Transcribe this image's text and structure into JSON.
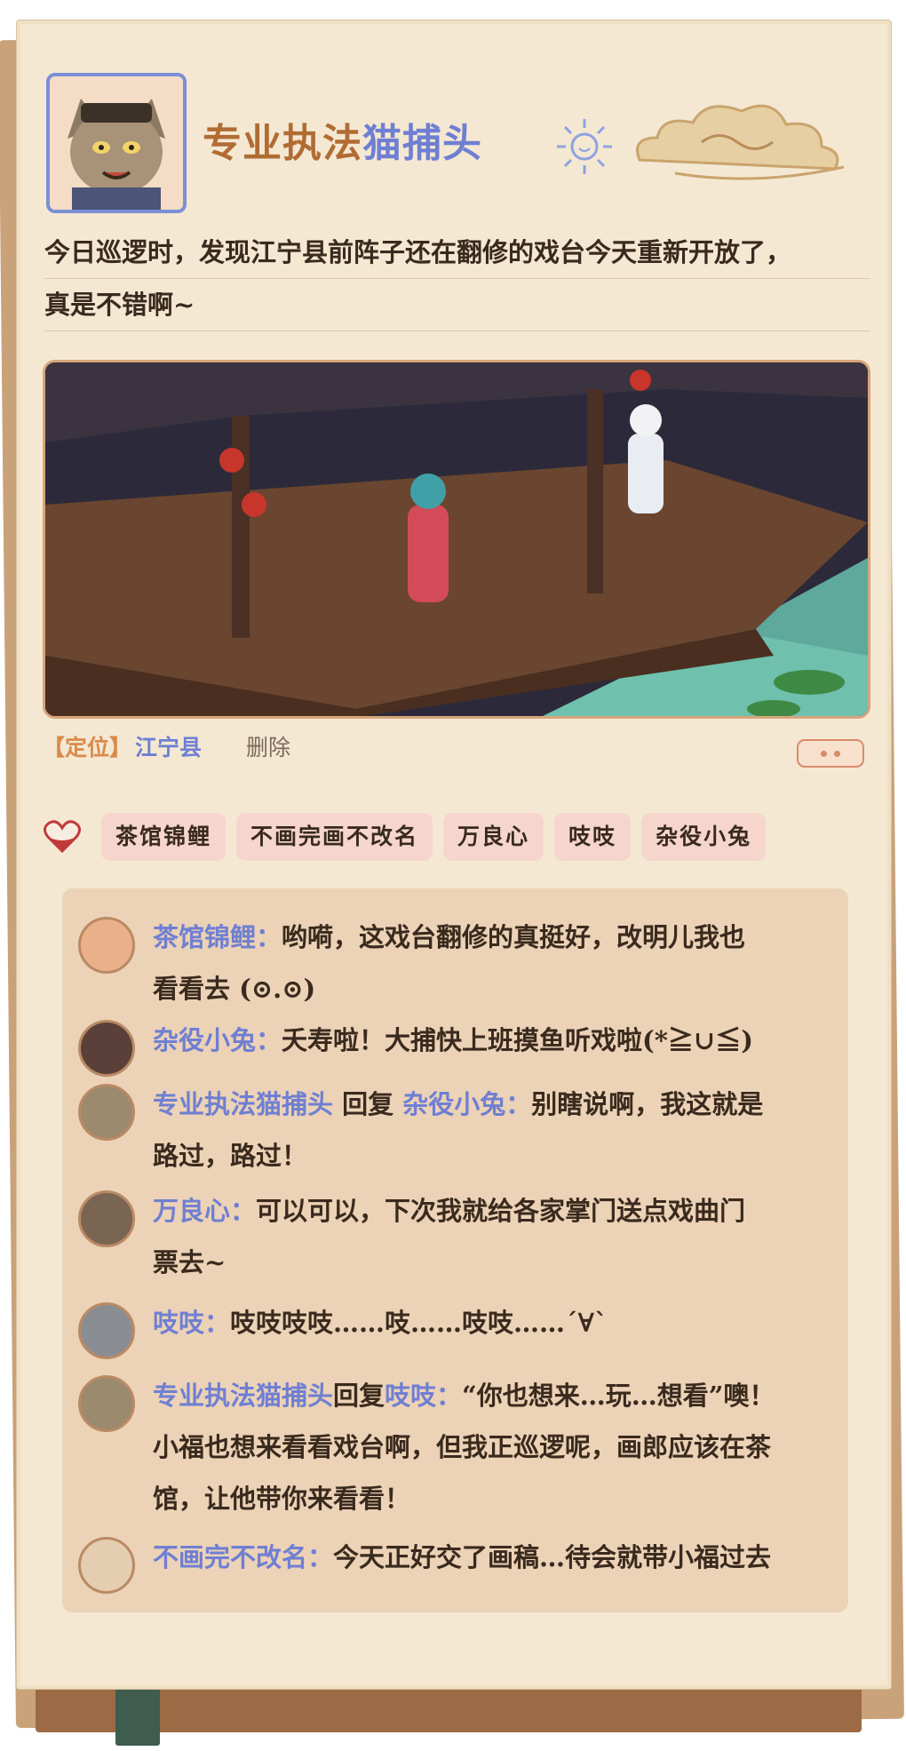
{
  "post": {
    "author_name_part1": "专业执法",
    "author_name_part2": "猫",
    "author_name_part3": "捕头",
    "text_line1": "今日巡逻时，发现江宁县前阵子还在翻修的戏台今天重新开放了，",
    "text_line2": "真是不错啊~",
    "location_tag": "【定位】",
    "location_name": "江宁县",
    "delete_label": "删除"
  },
  "likes": [
    "茶馆锦鲤",
    "不画完画不改名",
    "万良心",
    "吱吱",
    "杂役小兔"
  ],
  "comments": [
    {
      "name": "茶馆锦鲤：",
      "line1": "哟嗬，这戏台翻修的真挺好，改明儿我也",
      "line2": "看看去 (⊙.⊙)"
    },
    {
      "name": "杂役小兔：",
      "line1": "夭寿啦！大捕快上班摸鱼听戏啦(*≧∪≦)"
    },
    {
      "name": "专业执法猫捕头",
      "reply_word": " 回复 ",
      "reply_to": "杂役小兔：",
      "line1": "别瞎说啊，我这就是",
      "line2": "路过，路过！"
    },
    {
      "name": "万良心：",
      "line1": "可以可以，下次我就给各家掌门送点戏曲门",
      "line2": "票去~"
    },
    {
      "name": "吱吱：",
      "line1": "吱吱吱吱……吱……吱吱……´∀`"
    },
    {
      "name": "专业执法猫捕头",
      "reply_word": "回复",
      "reply_to": "吱吱：",
      "line1": "“你也想来…玩…想看”噢！",
      "line2": "小福也想来看看戏台啊，但我正巡逻呢，画郎应该在茶",
      "line3": "馆，让他带你来看看！"
    },
    {
      "name": "不画完不改名：",
      "line1": "今天正好交了画稿…待会就带小福过去"
    }
  ],
  "colors": {
    "name_blue": "#6f7fd2",
    "title_orange": "#b06c33",
    "paper": "#f4e8d3",
    "comment_bg": "#ecd2b6"
  }
}
